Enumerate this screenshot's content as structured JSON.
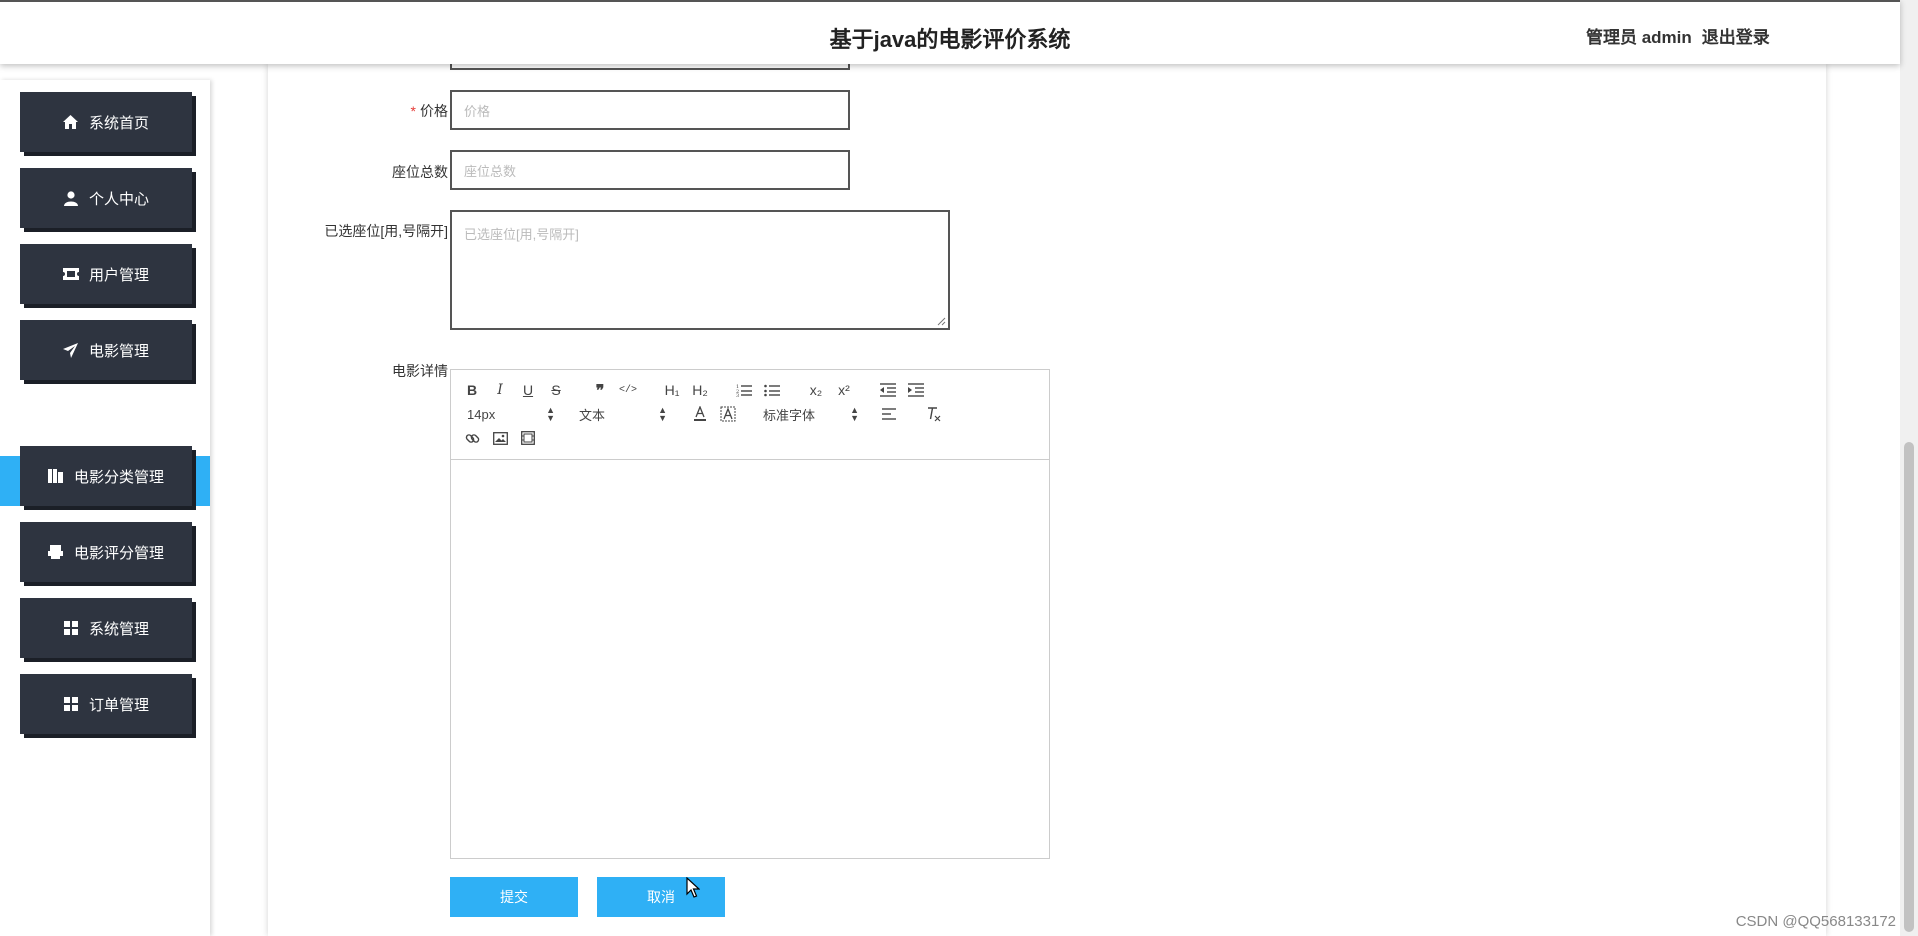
{
  "header": {
    "title": "基于java的电影评价系统",
    "user_label": "管理员 admin",
    "logout_label": "退出登录"
  },
  "sidebar": {
    "items": [
      {
        "label": "系统首页",
        "icon": "home-icon"
      },
      {
        "label": "个人中心",
        "icon": "user-icon"
      },
      {
        "label": "用户管理",
        "icon": "ticket-icon"
      },
      {
        "label": "电影管理",
        "icon": "paper-plane-icon"
      },
      {
        "label": "电影分类管理",
        "icon": "columns-icon"
      },
      {
        "label": "电影评分管理",
        "icon": "printer-icon"
      },
      {
        "label": "系统管理",
        "icon": "grid-icon"
      },
      {
        "label": "订单管理",
        "icon": "grid-icon"
      }
    ],
    "active_sub": "电影"
  },
  "form": {
    "price": {
      "label": "价格",
      "placeholder": "价格",
      "required": true
    },
    "seats_total": {
      "label": "座位总数",
      "placeholder": "座位总数"
    },
    "selected_seats": {
      "label": "已选座位[用,号隔开]",
      "placeholder": "已选座位[用,号隔开]"
    },
    "details": {
      "label": "电影详情"
    }
  },
  "editor": {
    "font_size": "14px",
    "text_type": "文本",
    "font_family": "标准字体",
    "bold": "B",
    "italic": "I",
    "underline": "U",
    "strike": "S",
    "quote": "❞",
    "code": "</>",
    "h1": "H₁",
    "h2": "H₂",
    "sub": "x₂",
    "sup": "x²"
  },
  "buttons": {
    "submit": "提交",
    "cancel": "取消"
  },
  "watermark": "CSDN @QQ568133172",
  "colors": {
    "accent": "#2fb0f5",
    "sidebar_button": "#2e3440",
    "required": "#e53935"
  }
}
